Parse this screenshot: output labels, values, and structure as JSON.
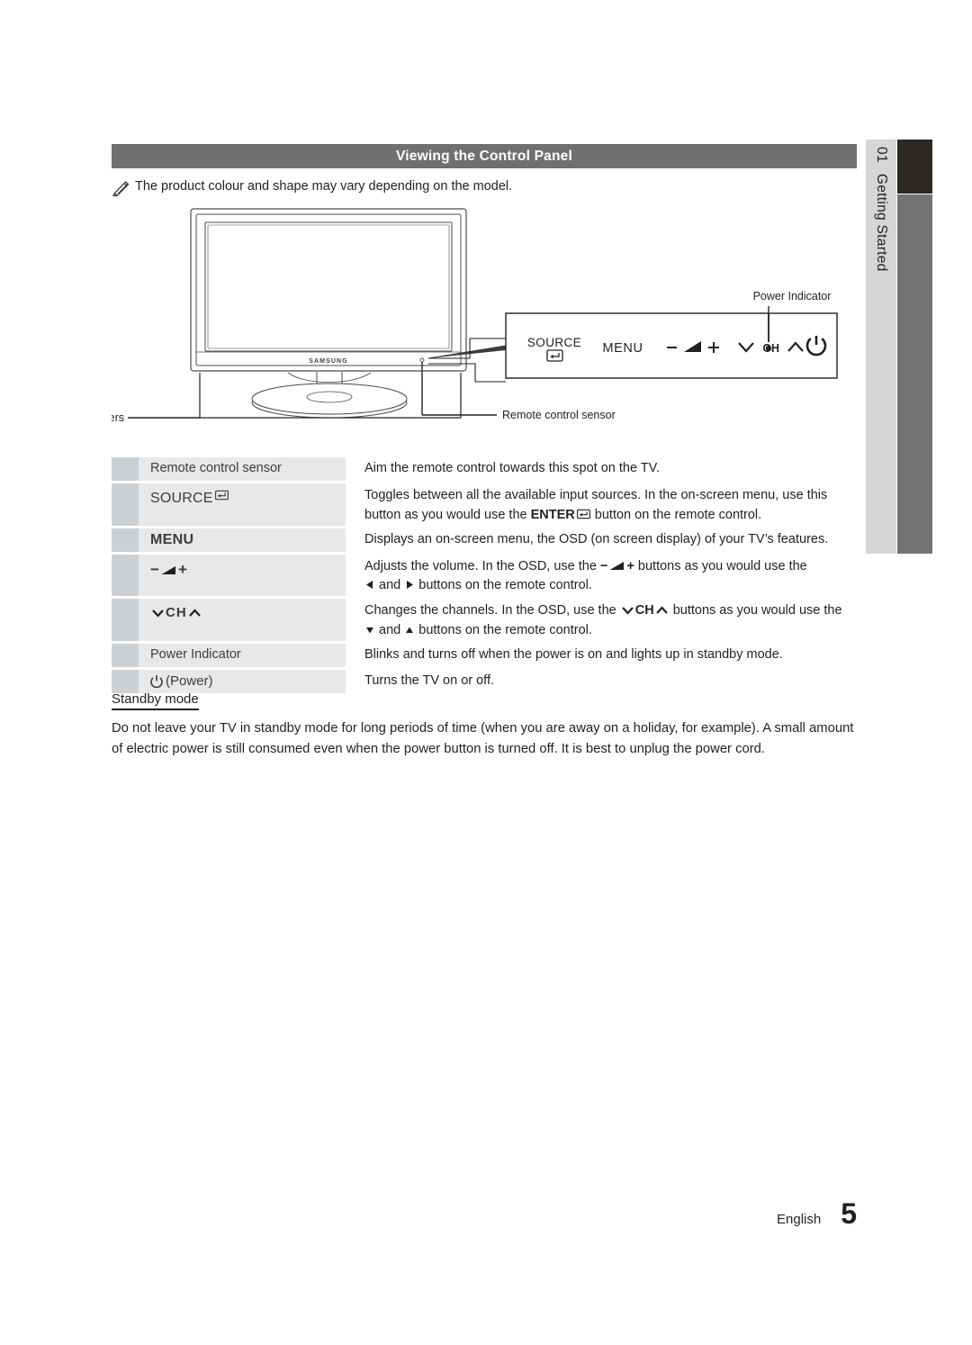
{
  "section": {
    "title": "Viewing the Control Panel",
    "note": "The product colour and shape may vary depending on the model.",
    "note_icon": "pencil-icon"
  },
  "side_tab": {
    "number": "01",
    "label": "Getting Started"
  },
  "illustration": {
    "tv_brand": "SAMSUNG",
    "callouts": {
      "speakers": "Speakers",
      "remote_sensor": "Remote control sensor",
      "power_indicator": "Power Indicator"
    },
    "panel_buttons": {
      "source": "SOURCE",
      "source_icon": "enter-icon",
      "menu": "MENU",
      "volume_minus": "−",
      "volume_icon": "volume-icon",
      "volume_plus": "+",
      "ch_down_icon": "chevron-down-icon",
      "ch": "CH",
      "ch_up_icon": "chevron-up-icon",
      "indicator_dot": "power-indicator-dot",
      "power_icon": "power-icon"
    }
  },
  "table": {
    "rows": [
      {
        "label": "Remote control sensor",
        "label_style": "plain",
        "desc_lines": [
          "Aim the remote control towards this spot on the TV."
        ]
      },
      {
        "label": "SOURCE",
        "label_style": "source",
        "label_icon": "enter-icon",
        "desc_lines": [
          "Toggles between all the available input sources. In the on-screen menu, use this",
          "button as you would use the ENTER button on the remote control."
        ],
        "desc_parts_line2": {
          "pre": "button as you would use the ",
          "bold": "ENTER",
          "icon": "enter-icon",
          "post": " button on the remote control."
        }
      },
      {
        "label": "MENU",
        "label_style": "menu",
        "desc_lines": [
          "Displays an on-screen menu, the OSD (on screen display) of your TV’s features."
        ]
      },
      {
        "label": "− ◢ +",
        "label_style": "volume",
        "desc_parts": {
          "line1_pre": "Adjusts the volume. In the OSD, use the ",
          "line1_sym_minus": "−",
          "line1_sym_plus": "+",
          "line1_post": " buttons as you would use the",
          "line2_left_tri": "◀",
          "line2_mid": " and ",
          "line2_right_tri": "▶",
          "line2_post": " buttons on the remote control."
        }
      },
      {
        "label": "∨ CH ∧",
        "label_style": "ch",
        "desc_parts": {
          "line1_pre": "Changes the channels. In the OSD, use the ",
          "line1_ch": "CH",
          "line1_post": " buttons as you would use the",
          "line2_down_tri": "▼",
          "line2_mid": " and ",
          "line2_up_tri": "▲",
          "line2_post": " buttons on the remote control."
        }
      },
      {
        "label": "Power Indicator",
        "label_style": "plain",
        "desc_lines": [
          "Blinks and turns off when the power is on and lights up in standby mode."
        ]
      },
      {
        "label": "(Power)",
        "label_style": "power",
        "label_icon": "power-icon",
        "desc_lines": [
          "Turns the TV on or off."
        ]
      }
    ]
  },
  "standby": {
    "title": "Standby mode",
    "body": "Do not leave your TV in standby mode for long periods of time (when you are away on a holiday, for example). A small amount of electric power is still consumed even when the power button is turned off. It is best to unplug the power cord."
  },
  "footer": {
    "language": "English",
    "page": "5"
  },
  "colors": {
    "header_bar": "#6e7072",
    "side_tab": "#d4d6d7",
    "side_bar_dark": "#2b2826",
    "side_bar_grey": "#737373",
    "row_swatch": "#cdd0d3",
    "row_label_bg": "#e6e8ea",
    "text": "#231f20"
  }
}
